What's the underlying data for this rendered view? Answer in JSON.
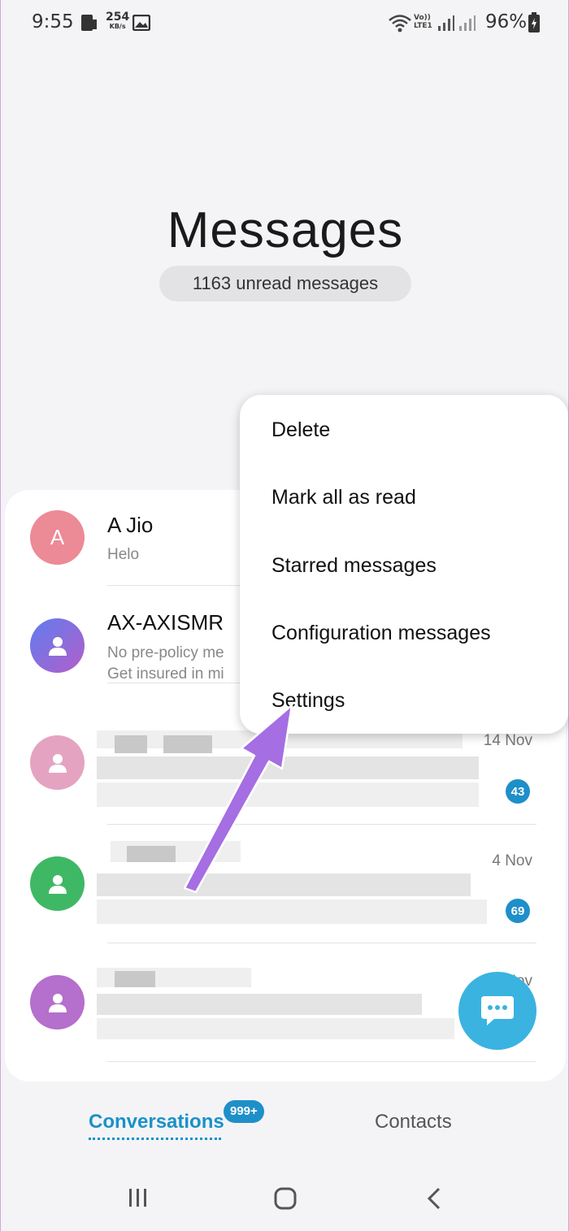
{
  "status_bar": {
    "time": "9:55",
    "speed_value": "254",
    "speed_unit": "KB/s",
    "lte_label_top": "Vo))",
    "lte_label_bottom": "LTE1",
    "battery": "96%"
  },
  "header": {
    "title": "Messages",
    "unread": "1163 unread messages"
  },
  "conversations": [
    {
      "avatar_letter": "A",
      "avatar_color": "#ec8a96",
      "name": "A Jio",
      "preview": "Helo"
    },
    {
      "avatar_color": "#7b6bd6",
      "name": "AX-AXISMR",
      "preview_line1": "No pre-policy me",
      "preview_line2": "Get insured in mi"
    },
    {
      "avatar_color": "#e4a4c1",
      "date": "14 Nov",
      "badge": "43"
    },
    {
      "avatar_color": "#3fb865",
      "date": "4 Nov",
      "badge": "69"
    },
    {
      "avatar_color": "#b56fcc",
      "date": "Nov"
    }
  ],
  "menu": {
    "items": [
      "Delete",
      "Mark all as read",
      "Starred messages",
      "Configuration messages",
      "Settings"
    ]
  },
  "tabs": {
    "conversations": "Conversations",
    "conversations_badge": "999+",
    "contacts": "Contacts"
  },
  "colors": {
    "accent": "#1a91c9",
    "fab": "#3ab3e0",
    "annotation_arrow": "#a56ee3"
  },
  "icons": {
    "fab": "chat-bubble-icon",
    "nav_recents": "recents-icon",
    "nav_home": "home-icon",
    "nav_back": "back-icon"
  }
}
